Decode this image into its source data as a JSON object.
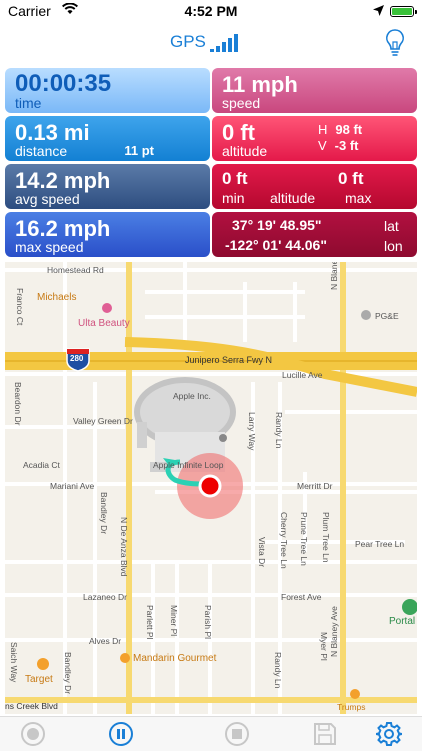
{
  "status_bar": {
    "carrier": "Carrier",
    "time": "4:52 PM"
  },
  "nav": {
    "gps_label": "GPS",
    "gps_bars": 5,
    "accent": "#1a7fd6"
  },
  "tiles": {
    "time": {
      "value": "00:00:35",
      "label": "time"
    },
    "speed": {
      "value": "11 mph",
      "label": "speed"
    },
    "distance": {
      "value": "0.13 mi",
      "label": "distance",
      "points": "11 pt"
    },
    "altitude": {
      "value": "0 ft",
      "label": "altitude",
      "h_label": "H",
      "h_value": "98 ft",
      "v_label": "V",
      "v_value": "-3 ft"
    },
    "avg_speed": {
      "value": "14.2 mph",
      "label": "avg speed"
    },
    "minmax": {
      "min_value": "0 ft",
      "max_value": "0 ft",
      "min_label": "min",
      "alt_label": "altitude",
      "max_label": "max"
    },
    "max_speed": {
      "value": "16.2 mph",
      "label": "max speed"
    },
    "coords": {
      "lat": "37° 19' 48.95\"",
      "lat_label": "lat",
      "lon": "-122° 01' 44.06\"",
      "lon_label": "lon"
    }
  },
  "map": {
    "labels": {
      "homestead": "Homestead Rd",
      "franco": "Franco Ct",
      "michaels": "Michaels",
      "ulta": "Ulta Beauty",
      "pge": "PG&E",
      "blaney_top": "N Blaney Ave",
      "shield": "280",
      "junipero": "Junipero Serra Fwy N",
      "lucille": "Lucille Ave",
      "beardon": "Beardon Dr",
      "apple": "Apple Inc.",
      "valley_green": "Valley Green Dr",
      "acadia": "Acadia Ct",
      "apple_inf": "Apple Infinite Loop",
      "larry": "Larry Way",
      "randy": "Randy Ln",
      "mariani": "Mariani Ave",
      "merritt": "Merritt Dr",
      "bandley": "Bandley Dr",
      "de_anza": "N De Anza Blvd",
      "cherry": "Cherry Tree Ln",
      "prune": "Prune Tree Ln",
      "plum": "Plum Tree Ln",
      "pear": "Pear Tree Ln",
      "vista": "Vista Dr",
      "forest": "Forest Ave",
      "lazaneo": "Lazaneo Dr",
      "parlett": "Parlett Pl",
      "miner": "Miner Pl",
      "parish": "Parish Pl",
      "portal": "Portal",
      "blaney_bottom": "N Blaney Ave",
      "myer": "Myer Pl",
      "alves": "Alves Dr",
      "mandarin": "Mandarin Gourmet",
      "saich": "Saich Way",
      "target": "Target",
      "bandley2": "Bandley Dr",
      "randy2": "Randy Ln",
      "stevens": "ns Creek Blvd",
      "trumps": "Trumps"
    }
  },
  "tabbar": {
    "items": [
      "record",
      "pause",
      "stop",
      "save",
      "settings"
    ]
  }
}
